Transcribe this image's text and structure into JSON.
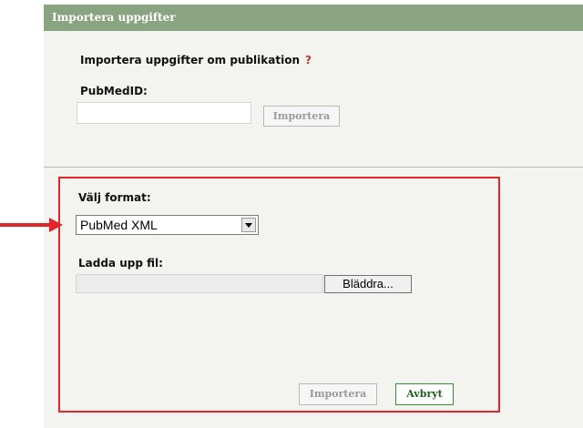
{
  "header": {
    "title": "Importera uppgifter"
  },
  "pubmed_section": {
    "title": "Importera uppgifter om publikation",
    "help_mark": "?",
    "pubmed_label": "PubMedID:",
    "pubmed_value": "",
    "import_button": "Importera"
  },
  "file_section": {
    "format_label": "Välj format:",
    "format_selected": "PubMed XML",
    "upload_label": "Ladda upp fil:",
    "file_value": "",
    "browse_button": "Bläddra...",
    "import_button": "Importera",
    "cancel_button": "Avbryt"
  },
  "colors": {
    "header_bg": "#8aa482",
    "panel_bg": "#f3f3f0",
    "highlight_red": "#e0262b",
    "cancel_green": "#3a8f35"
  },
  "icons": {
    "select_arrow": "chevron-down-icon",
    "pointer_arrow": "arrow-right-icon"
  }
}
